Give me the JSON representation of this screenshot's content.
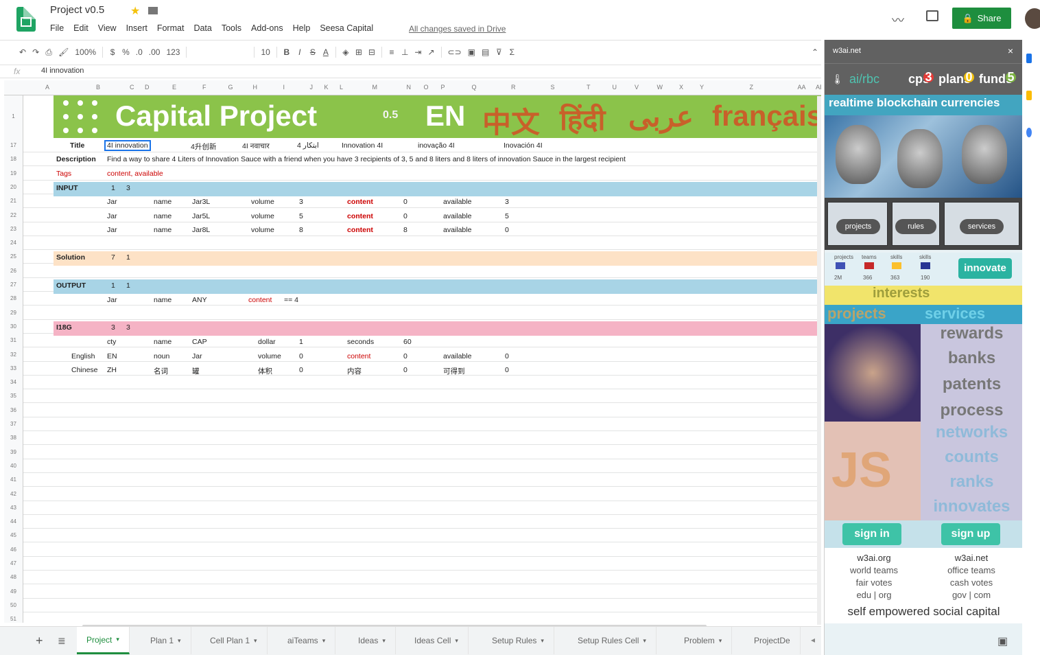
{
  "app": {
    "doc_title": "Project v0.5",
    "menus": [
      "File",
      "Edit",
      "View",
      "Insert",
      "Format",
      "Data",
      "Tools",
      "Add-ons",
      "Help",
      "Seesa Capital"
    ],
    "saved_status": "All changes saved in Drive",
    "share_label": "Share"
  },
  "toolbar": {
    "zoom": "100%",
    "decimals1": ".0",
    "decimals2": ".00",
    "format123": "123",
    "font_size": "10",
    "bold": "B",
    "italic": "I",
    "strike": "S",
    "textcolor": "A",
    "sum": "Σ"
  },
  "formula": {
    "label": "fx",
    "value": "4I innovation"
  },
  "sheet": {
    "cols": [
      "A",
      "B",
      "C",
      "D",
      "E",
      "F",
      "G",
      "H",
      "I",
      "J",
      "K",
      "L",
      "M",
      "N",
      "O",
      "P",
      "Q",
      "R",
      "S",
      "T",
      "U",
      "V",
      "W",
      "X",
      "Y",
      "Z",
      "AA",
      "AB"
    ],
    "rows": [
      "1",
      "17",
      "18",
      "19",
      "20",
      "21",
      "22",
      "23",
      "24",
      "25",
      "26",
      "27",
      "28",
      "29",
      "30",
      "31",
      "32",
      "33",
      "34",
      "35",
      "36",
      "37",
      "38",
      "39",
      "40",
      "41",
      "42",
      "43",
      "44",
      "45",
      "46",
      "47",
      "48",
      "49",
      "50",
      "51"
    ],
    "banner": {
      "title": "Capital Project",
      "version": "0.5",
      "en": "EN",
      "zh": "中文",
      "hi": "हिंदी",
      "ar": "عربى",
      "fr": "français"
    },
    "row17": {
      "label": "Title",
      "a": "4I innovation",
      "b": "4升创新",
      "c": "4I नवाचार",
      "d": "4 ابتكار",
      "e": "Innovation 4I",
      "f": "inovação 4I",
      "g": "Inovación 4I"
    },
    "row18": {
      "label": "Description",
      "text": "Find a way to share 4 Liters of Innovation Sauce with a friend when you have 3 recipients of 3, 5 and 8 liters and 8 liters of innovation Sauce in the largest recipient"
    },
    "row19": {
      "label": "Tags",
      "text": "content, available"
    },
    "row20": {
      "label": "INPUT",
      "n1": "1",
      "n2": "3"
    },
    "inputs": [
      {
        "k": "Jar",
        "name_k": "name",
        "name_v": "Jar3L",
        "vol_k": "volume",
        "vol_v": "3",
        "content_k": "content",
        "content_v": "0",
        "avail_k": "available",
        "avail_v": "3"
      },
      {
        "k": "Jar",
        "name_k": "name",
        "name_v": "Jar5L",
        "vol_k": "volume",
        "vol_v": "5",
        "content_k": "content",
        "content_v": "0",
        "avail_k": "available",
        "avail_v": "5"
      },
      {
        "k": "Jar",
        "name_k": "name",
        "name_v": "Jar8L",
        "vol_k": "volume",
        "vol_v": "8",
        "content_k": "content",
        "content_v": "8",
        "avail_k": "available",
        "avail_v": "0"
      }
    ],
    "row25": {
      "label": "Solution",
      "n1": "7",
      "n2": "1"
    },
    "row27": {
      "label": "OUTPUT",
      "n1": "1",
      "n2": "1"
    },
    "row28": {
      "k": "Jar",
      "name_k": "name",
      "name_v": "ANY",
      "content_k": "content",
      "content_v": "== 4"
    },
    "row30": {
      "label": "I18G",
      "n1": "3",
      "n2": "3"
    },
    "i18n": [
      {
        "lang": "",
        "code": "cty",
        "name_k": "name",
        "name_v": "CAP",
        "vol_k": "dollar",
        "vol_v": "1",
        "content_k": "seconds",
        "content_v": "60",
        "avail_k": "",
        "avail_v": ""
      },
      {
        "lang": "English",
        "code": "EN",
        "name_k": "noun",
        "name_v": "Jar",
        "vol_k": "volume",
        "vol_v": "0",
        "content_k": "content",
        "content_v": "0",
        "avail_k": "available",
        "avail_v": "0"
      },
      {
        "lang": "Chinese",
        "code": "ZH",
        "name_k": "名词",
        "name_v": "罐",
        "vol_k": "体积",
        "vol_v": "0",
        "content_k": "内容",
        "content_v": "0",
        "avail_k": "可得到",
        "avail_v": "0"
      }
    ]
  },
  "tabs": [
    "Project",
    "Plan 1",
    "Cell Plan 1",
    "aiTeams",
    "Ideas",
    "Ideas Cell",
    "Setup Rules",
    "Setup Rules Cell",
    "Problem",
    "ProjectDe"
  ],
  "side": {
    "header": "w3ai.net",
    "close": "×",
    "nav": {
      "left": "ai/rbc",
      "cps": "cps",
      "plans": "plans",
      "funds": "funds",
      "b1": "3",
      "b2": "0",
      "b3": "5"
    },
    "tagline": "realtime blockchain currencies",
    "thumbs": [
      "projects",
      "rules",
      "services"
    ],
    "innovate": "innovate",
    "stats_labels": [
      "projects",
      "teams",
      "skills",
      "skills"
    ],
    "stats_values": [
      "2M",
      "366",
      "363",
      "190"
    ],
    "interests": "interests",
    "projects_word": "projects",
    "services_word": "services",
    "words": [
      "rewards",
      "banks",
      "patents",
      "process",
      "networks",
      "counts",
      "ranks",
      "innovates"
    ],
    "js": "JS",
    "signin": "sign in",
    "signup": "sign up",
    "left_links": [
      "w3ai.org",
      "world teams",
      "fair votes",
      "edu | org"
    ],
    "right_links": [
      "w3ai.net",
      "office teams",
      "cash votes",
      "gov | com"
    ],
    "slogan": "self empowered social capital"
  },
  "colors": {
    "green": "#8bc34a",
    "blue_row": "#a8d4e6",
    "peach_row": "#fde2c6",
    "pink_row": "#f5b3c5",
    "share": "#1e8e3e"
  }
}
